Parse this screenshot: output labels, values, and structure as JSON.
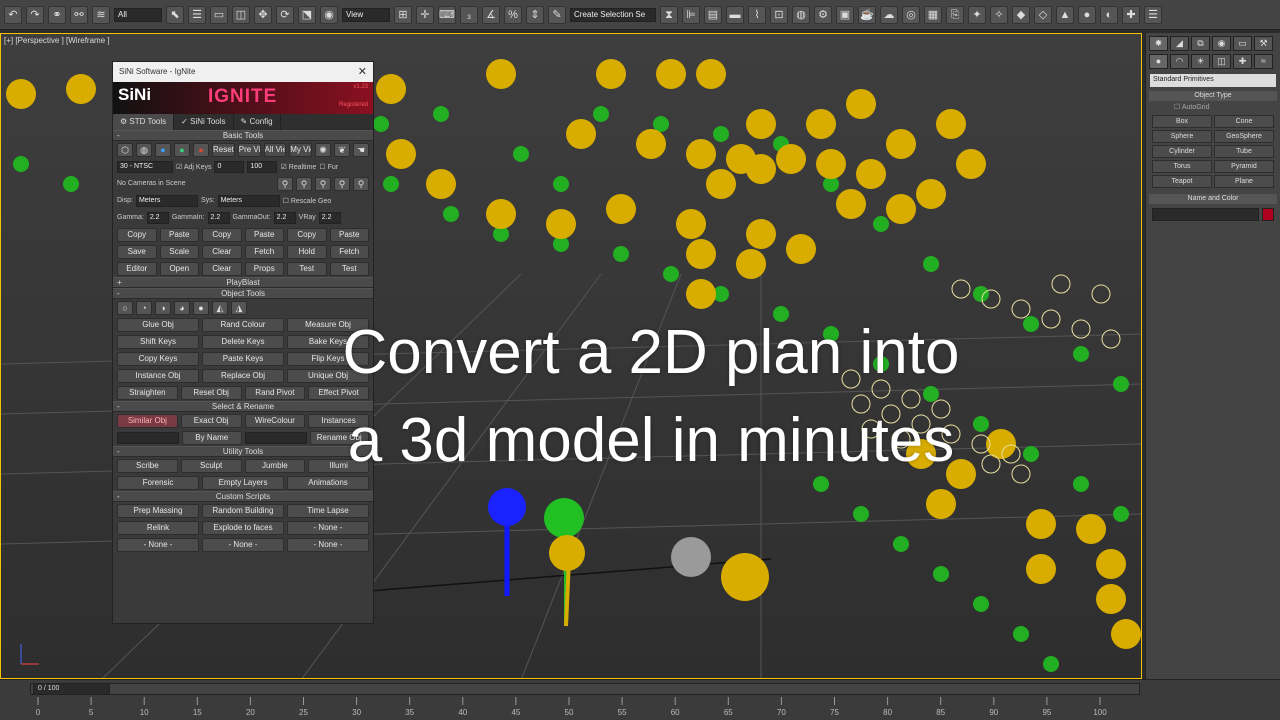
{
  "toolbar": {
    "filter_select": "All",
    "view_select": "View",
    "selection_set": "Create Selection Se"
  },
  "viewport": {
    "label": "[+] [Perspective ] [Wireframe ]"
  },
  "overlay": {
    "line1": "Convert a 2D plan into",
    "line2": "a 3d model in minutes"
  },
  "panel": {
    "title": "SiNi Software - IgNite",
    "logo": "SiNi",
    "brand": "IGNITE",
    "version": "v1.23",
    "registered": "Registered",
    "tabs": [
      "STD Tools",
      "SiNi Tools",
      "Config"
    ],
    "basic_tools": "Basic Tools",
    "view_buttons": [
      "Reset View",
      "Pre View",
      "All View",
      "My View"
    ],
    "fps_select": "30 - NTSC",
    "adj_keys": "Adj Keys",
    "frame_start": "0",
    "frame_end": "100",
    "realtime": "Realtime",
    "fur": "Fur",
    "cameras_info": "No Cameras in Scene",
    "disp_label": "Disp:",
    "disp_value": "Meters",
    "sys_label": "Sys:",
    "sys_value": "Meters",
    "rescale": "Rescale Geo",
    "gamma_label": "Gamma:",
    "gamma_value": "2.2",
    "gammain_label": "GammaIn:",
    "gammain_value": "2.2",
    "gammaout_label": "GammaOut:",
    "gammaout_value": "2.2",
    "vray_label": "VRay",
    "vray_value": "2.2",
    "clip_row1": [
      "Copy",
      "Paste",
      "Copy",
      "Paste",
      "Copy",
      "Paste"
    ],
    "clip_row2": [
      "Save",
      "Scale",
      "Clear",
      "Fetch",
      "Hold",
      "Fetch"
    ],
    "clip_row3": [
      "Editor",
      "Open",
      "Clear",
      "Props",
      "Test",
      "Test"
    ],
    "playblast": "PlayBlast",
    "object_tools": "Object Tools",
    "obj_rows": [
      [
        "Glue Obj",
        "Rand Colour",
        "Measure Obj"
      ],
      [
        "Shift Keys",
        "Delete Keys",
        "Bake Keys"
      ],
      [
        "Copy Keys",
        "Paste Keys",
        "Flip Keys"
      ],
      [
        "Instance Obj",
        "Replace Obj",
        "Unique Obj"
      ],
      [
        "Straighten",
        "Reset Obj",
        "Rand Pivot",
        "Effect Pivot"
      ]
    ],
    "select_rename": "Select & Rename",
    "sel_row": [
      "Similar Obj",
      "Exact Obj",
      "WireColour",
      "Instances"
    ],
    "by_name": "By Name",
    "rename_obj": "Rename Obj",
    "utility_tools": "Utility Tools",
    "util_row1": [
      "Scribe",
      "Sculpt",
      "Jumble",
      "Illumi"
    ],
    "util_row2": [
      "Forensic",
      "Empty Layers",
      "Animations"
    ],
    "custom_scripts": "Custom Scripts",
    "custom_row1": [
      "Prep Massing",
      "Random Building",
      "Time Lapse"
    ],
    "custom_row2": [
      "Relink",
      "Explode to faces",
      "- None -"
    ],
    "custom_row3": [
      "- None -",
      "- None -",
      "- None -"
    ]
  },
  "command_panel": {
    "category": "Standard Primitives",
    "object_type": "Object Type",
    "autogrid": "AutoGrid",
    "primitives": [
      "Box",
      "Cone",
      "Sphere",
      "GeoSphere",
      "Cylinder",
      "Tube",
      "Torus",
      "Pyramid",
      "Teapot",
      "Plane"
    ],
    "name_and_color": "Name and Color",
    "color": "#b00020"
  },
  "timeline": {
    "slider": "0 / 100",
    "ticks": [
      "0",
      "5",
      "10",
      "15",
      "20",
      "25",
      "30",
      "35",
      "40",
      "45",
      "50",
      "55",
      "60",
      "65",
      "70",
      "75",
      "80",
      "85",
      "90",
      "95",
      "100"
    ]
  }
}
